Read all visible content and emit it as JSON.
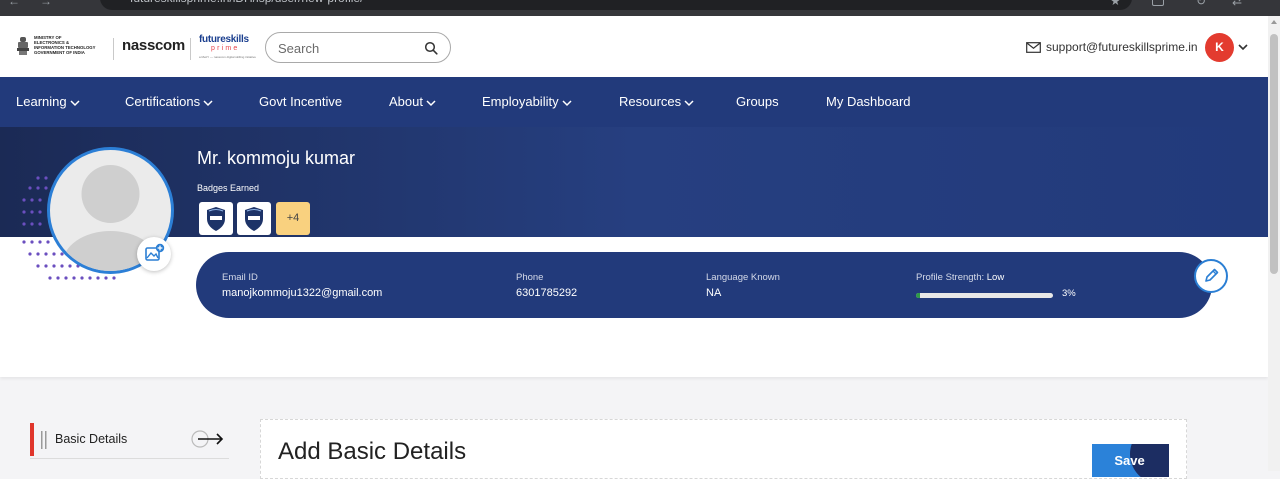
{
  "browser": {
    "url": "futureskillsprime.in/iDH/isp/user/new-profile/"
  },
  "header": {
    "meity_text": "MINISTRY OF\nELECTRONICS &\nINFORMATION TECHNOLOGY\nGOVERNMENT OF INDIA",
    "nasscom": "nasscom",
    "fsp_top": "futureskills",
    "fsp_bottom": "prime",
    "fsp_tagline": "a MeitY — nasscom digital skilling initiative",
    "search_placeholder": "Search",
    "support_email": "support@futureskillsprime.in",
    "avatar_initial": "K"
  },
  "nav": {
    "items": [
      {
        "label": "Learning",
        "dropdown": true
      },
      {
        "label": "Certifications",
        "dropdown": true
      },
      {
        "label": "Govt Incentive",
        "dropdown": false
      },
      {
        "label": "About",
        "dropdown": true
      },
      {
        "label": "Employability",
        "dropdown": true
      },
      {
        "label": "Resources",
        "dropdown": true
      },
      {
        "label": "Groups",
        "dropdown": false
      },
      {
        "label": "My Dashboard",
        "dropdown": false
      }
    ]
  },
  "profile": {
    "name": "Mr. kommoju kumar",
    "badges_label": "Badges Earned",
    "badges_more": "+4",
    "email_label": "Email ID",
    "email": "manojkommoju1322@gmail.com",
    "phone_label": "Phone",
    "phone": "6301785292",
    "language_label": "Language Known",
    "language": "NA",
    "strength_label": "Profile Strength:",
    "strength_level": "Low",
    "strength_percent": 3,
    "strength_text": "3%"
  },
  "sidebar": {
    "items": [
      {
        "label": "Basic Details",
        "active": true
      }
    ]
  },
  "main": {
    "title": "Add Basic Details",
    "save_label": "Save"
  },
  "colors": {
    "navy": "#223a7b",
    "accent_blue": "#2b82d9",
    "brand_red": "#e33b2f",
    "badge_more": "#f9d17f",
    "strength_green": "#2f9a48"
  }
}
